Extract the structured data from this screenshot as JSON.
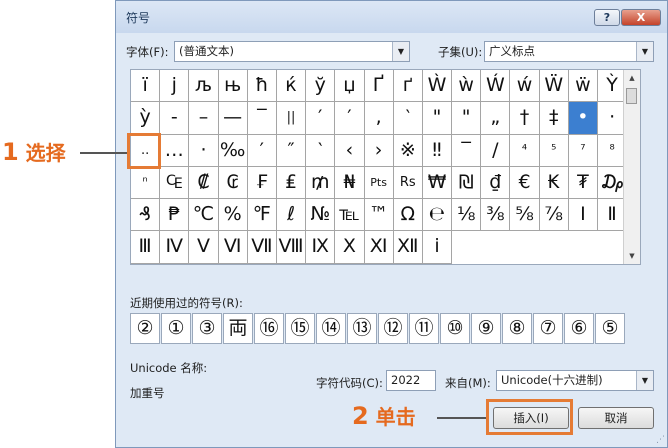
{
  "dialog": {
    "title": "符号",
    "help_label": "?",
    "close_label": "X"
  },
  "font": {
    "label": "字体(F):",
    "value": "(普通文本)"
  },
  "subset": {
    "label": "子集(U):",
    "value": "广义标点"
  },
  "symbol_rows": [
    [
      "ï",
      "j",
      "љ",
      "њ",
      "ħ",
      "ќ",
      "ў",
      "џ",
      "Ґ",
      "ґ",
      "Ẁ",
      "ẁ",
      "Ẃ",
      "ẃ",
      "Ẅ",
      "ẅ"
    ],
    [
      "Ỳ",
      "ỳ",
      "-",
      "–",
      "—",
      "‾",
      "||",
      "′",
      "′",
      ",",
      "‵",
      "\"",
      "\"",
      "„",
      "†",
      "‡"
    ],
    [
      "•",
      "·",
      "..",
      "…",
      "·",
      "‰",
      "′",
      "″",
      "‵",
      "‹",
      "›",
      "※",
      "‼",
      "‾",
      "/",
      "⁴"
    ],
    [
      "⁵",
      "⁷",
      "⁸",
      "ⁿ",
      "₠",
      "₡",
      "₢",
      "₣",
      "₤",
      "₥",
      "₦",
      "Pts",
      "Rs",
      "₩",
      "₪",
      "₫"
    ],
    [
      "€",
      "₭",
      "₮",
      "₯",
      "₰",
      "₱",
      "℃",
      "%",
      "℉",
      "ℓ",
      "№",
      "℡",
      "™",
      "Ω",
      "℮",
      "⅛"
    ],
    [
      "⅜",
      "⅝",
      "⅞",
      "Ⅰ",
      "Ⅱ",
      "Ⅲ",
      "Ⅳ",
      "Ⅴ",
      "Ⅵ",
      "Ⅶ",
      "Ⅷ",
      "Ⅸ",
      "Ⅹ",
      "Ⅺ",
      "Ⅻ",
      "ⅰ"
    ]
  ],
  "recent": {
    "label": "近期使用过的符号(R):",
    "symbols": [
      "②",
      "①",
      "③",
      "両",
      "⑯",
      "⑮",
      "⑭",
      "⑬",
      "⑫",
      "⑪",
      "⑩",
      "⑨",
      "⑧",
      "⑦",
      "⑥",
      "⑤"
    ]
  },
  "unicode": {
    "name_label": "Unicode 名称:",
    "name_value": "加重号"
  },
  "char_code": {
    "label": "字符代码(C):",
    "value": "2022"
  },
  "from": {
    "label": "来自(M):",
    "value": "Unicode(十六进制)"
  },
  "buttons": {
    "insert": "插入(I)",
    "cancel": "取消"
  },
  "callouts": {
    "step1": {
      "number": "1",
      "text": "选择"
    },
    "step2": {
      "number": "2",
      "text": "单击"
    }
  },
  "colors": {
    "highlight": "#e57b35",
    "selection": "#3c7fd0"
  }
}
